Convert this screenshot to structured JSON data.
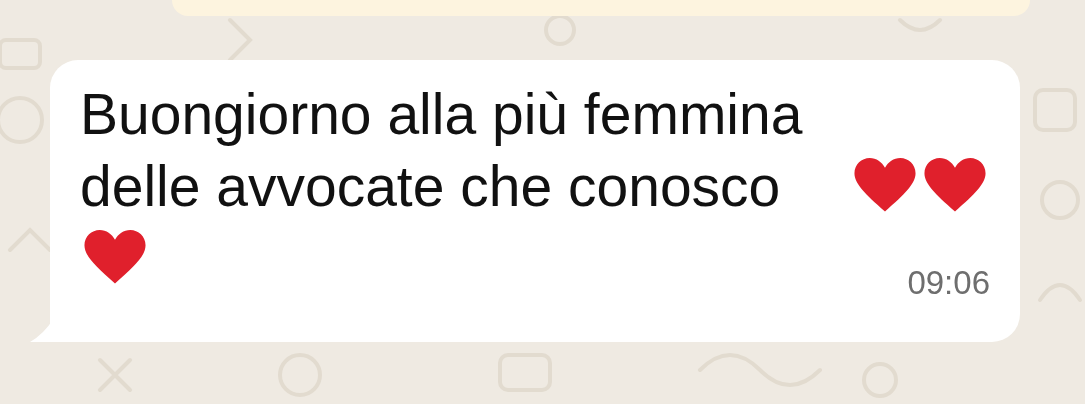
{
  "messages": [
    {
      "kind": "partial"
    },
    {
      "kind": "incoming",
      "text": "Buongiorno alla più femmina delle avvocate che conosco",
      "time": "09:06"
    }
  ]
}
